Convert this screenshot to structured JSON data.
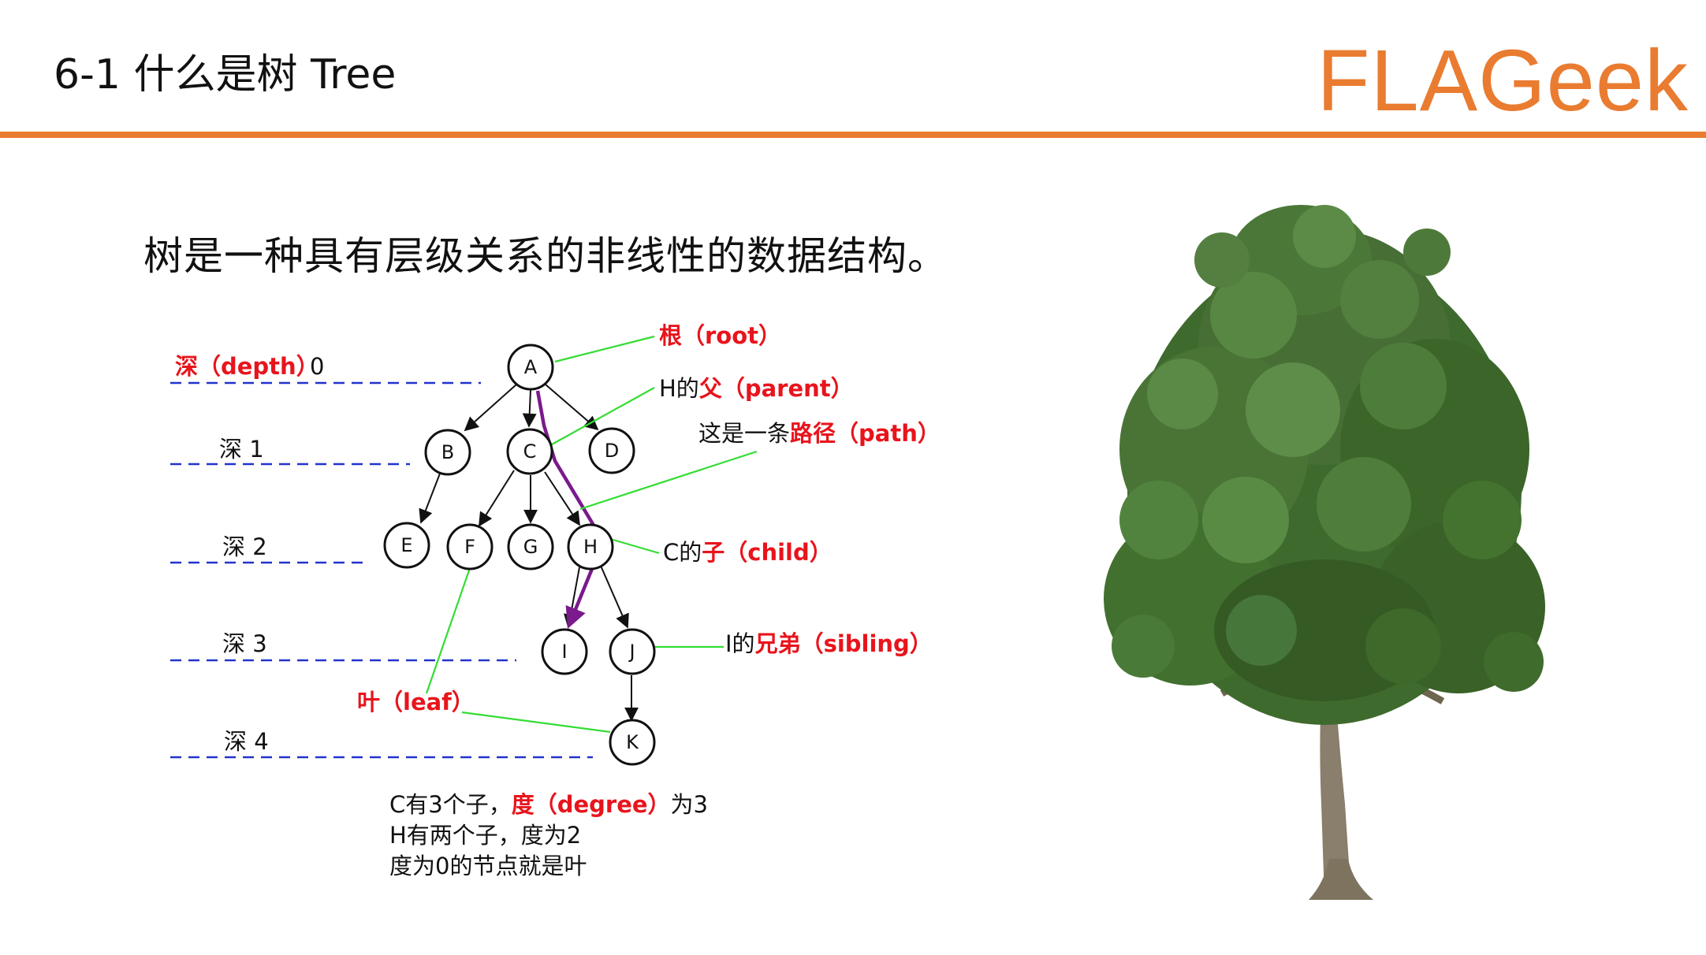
{
  "header": {
    "title": "6-1 什么是树 Tree",
    "logo": "FLAGeek",
    "accent_color": "#e97c30"
  },
  "subtitle": "树是一种具有层级关系的非线性的数据结构。",
  "diagram": {
    "depth_labels": {
      "depth0_red": "深（depth）",
      "depth0_num": "0",
      "depth1": "深 1",
      "depth2": "深 2",
      "depth3": "深 3",
      "depth4": "深 4"
    },
    "nodes": {
      "A": "A",
      "B": "B",
      "C": "C",
      "D": "D",
      "E": "E",
      "F": "F",
      "G": "G",
      "H": "H",
      "I": "I",
      "J": "J",
      "K": "K"
    },
    "annotations": {
      "root_red": "根（root）",
      "parent_black": "H的",
      "parent_red": "父（parent）",
      "path_black": "这是一条",
      "path_red": "路径（path）",
      "child_black": "C的",
      "child_red": "子（child）",
      "sibling_black": "I的",
      "sibling_red": "兄弟（sibling）",
      "leaf_red": "叶（leaf）"
    },
    "notes": {
      "line1_a": "C有3个子，",
      "line1_red": "度（degree）",
      "line1_b": "为3",
      "line2": "H有两个子，度为2",
      "line3": "度为0的节点就是叶"
    },
    "colors": {
      "label_red": "#e8141c",
      "callout_green": "#33dd33",
      "path_purple": "#7a1a8c",
      "depth_line_blue": "#2233cc"
    }
  },
  "illustration": {
    "icon": "oak-tree-photo"
  }
}
